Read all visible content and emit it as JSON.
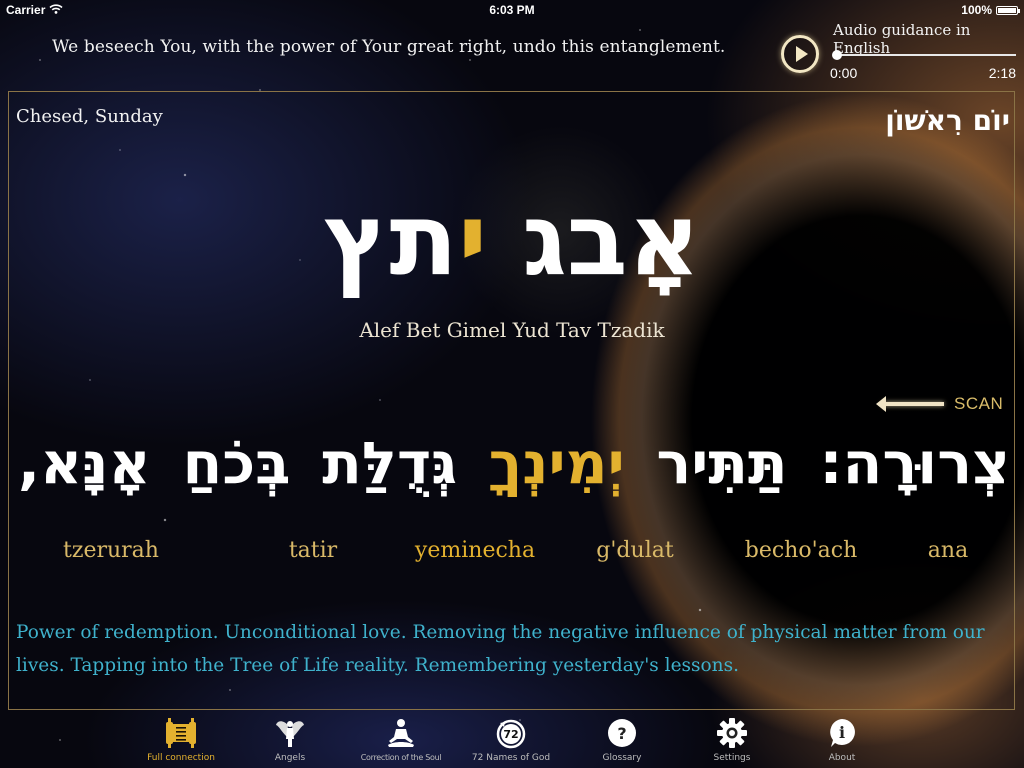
{
  "status_bar": {
    "carrier": "Carrier",
    "time": "6:03 PM",
    "battery": "100%",
    "battery_level": 1.0
  },
  "header": {
    "prayer_line": "We beseech You, with the power of Your great right, undo this entanglement."
  },
  "audio": {
    "title": "Audio guidance in English",
    "current_time": "0:00",
    "duration": "2:18",
    "progress": 0.0,
    "play_icon": "play-icon"
  },
  "panel": {
    "sefira_day": "Chesed, Sunday",
    "day_hebrew": "יוֹם רִאשׁוֹן",
    "name_hebrew": {
      "before_gold": "אָבג ",
      "gold": "י",
      "after_gold": "תץ"
    },
    "name_transliteration": "Alef Bet Gimel Yud Tav Tzadik",
    "scan_label": "SCAN",
    "verse_words": [
      {
        "hebrew": "אָנָּא,",
        "translit": "ana",
        "highlight": false
      },
      {
        "hebrew": "בְּכֹחַ",
        "translit": "becho'ach",
        "highlight": false
      },
      {
        "hebrew": "גְּדֻלַּת",
        "translit": "g'dulat",
        "highlight": false
      },
      {
        "hebrew": "יְמִינְךָ",
        "translit": "yeminecha",
        "highlight": true
      },
      {
        "hebrew": "תַּתִּיר",
        "translit": "tatir",
        "highlight": false
      },
      {
        "hebrew": "צְרוּרָה:",
        "translit": "tzerurah",
        "highlight": false
      }
    ],
    "meaning": "Power of redemption. Unconditional love. Removing the negative influence of physical matter from our lives. Tapping into the Tree of Life reality. Remembering yesterday's lessons."
  },
  "tabs": [
    {
      "label": "Full connection",
      "icon": "scroll-icon",
      "active": true
    },
    {
      "label": "Angels",
      "icon": "angel-icon",
      "active": false
    },
    {
      "label": "Correction of the Soul",
      "icon": "meditation-icon",
      "active": false
    },
    {
      "label": "72 Names of God",
      "icon": "72-names-icon",
      "active": false,
      "badge": "72"
    },
    {
      "label": "Glossary",
      "icon": "question-icon",
      "active": false,
      "badge": "?"
    },
    {
      "label": "Settings",
      "icon": "gear-icon",
      "active": false
    },
    {
      "label": "About",
      "icon": "info-icon",
      "active": false,
      "badge": "i"
    }
  ],
  "colors": {
    "accent_gold": "#e3b12f",
    "translit_gold": "#d9b968",
    "meaning_cyan": "#3fb2cc",
    "frame_border": "#8a7346"
  }
}
